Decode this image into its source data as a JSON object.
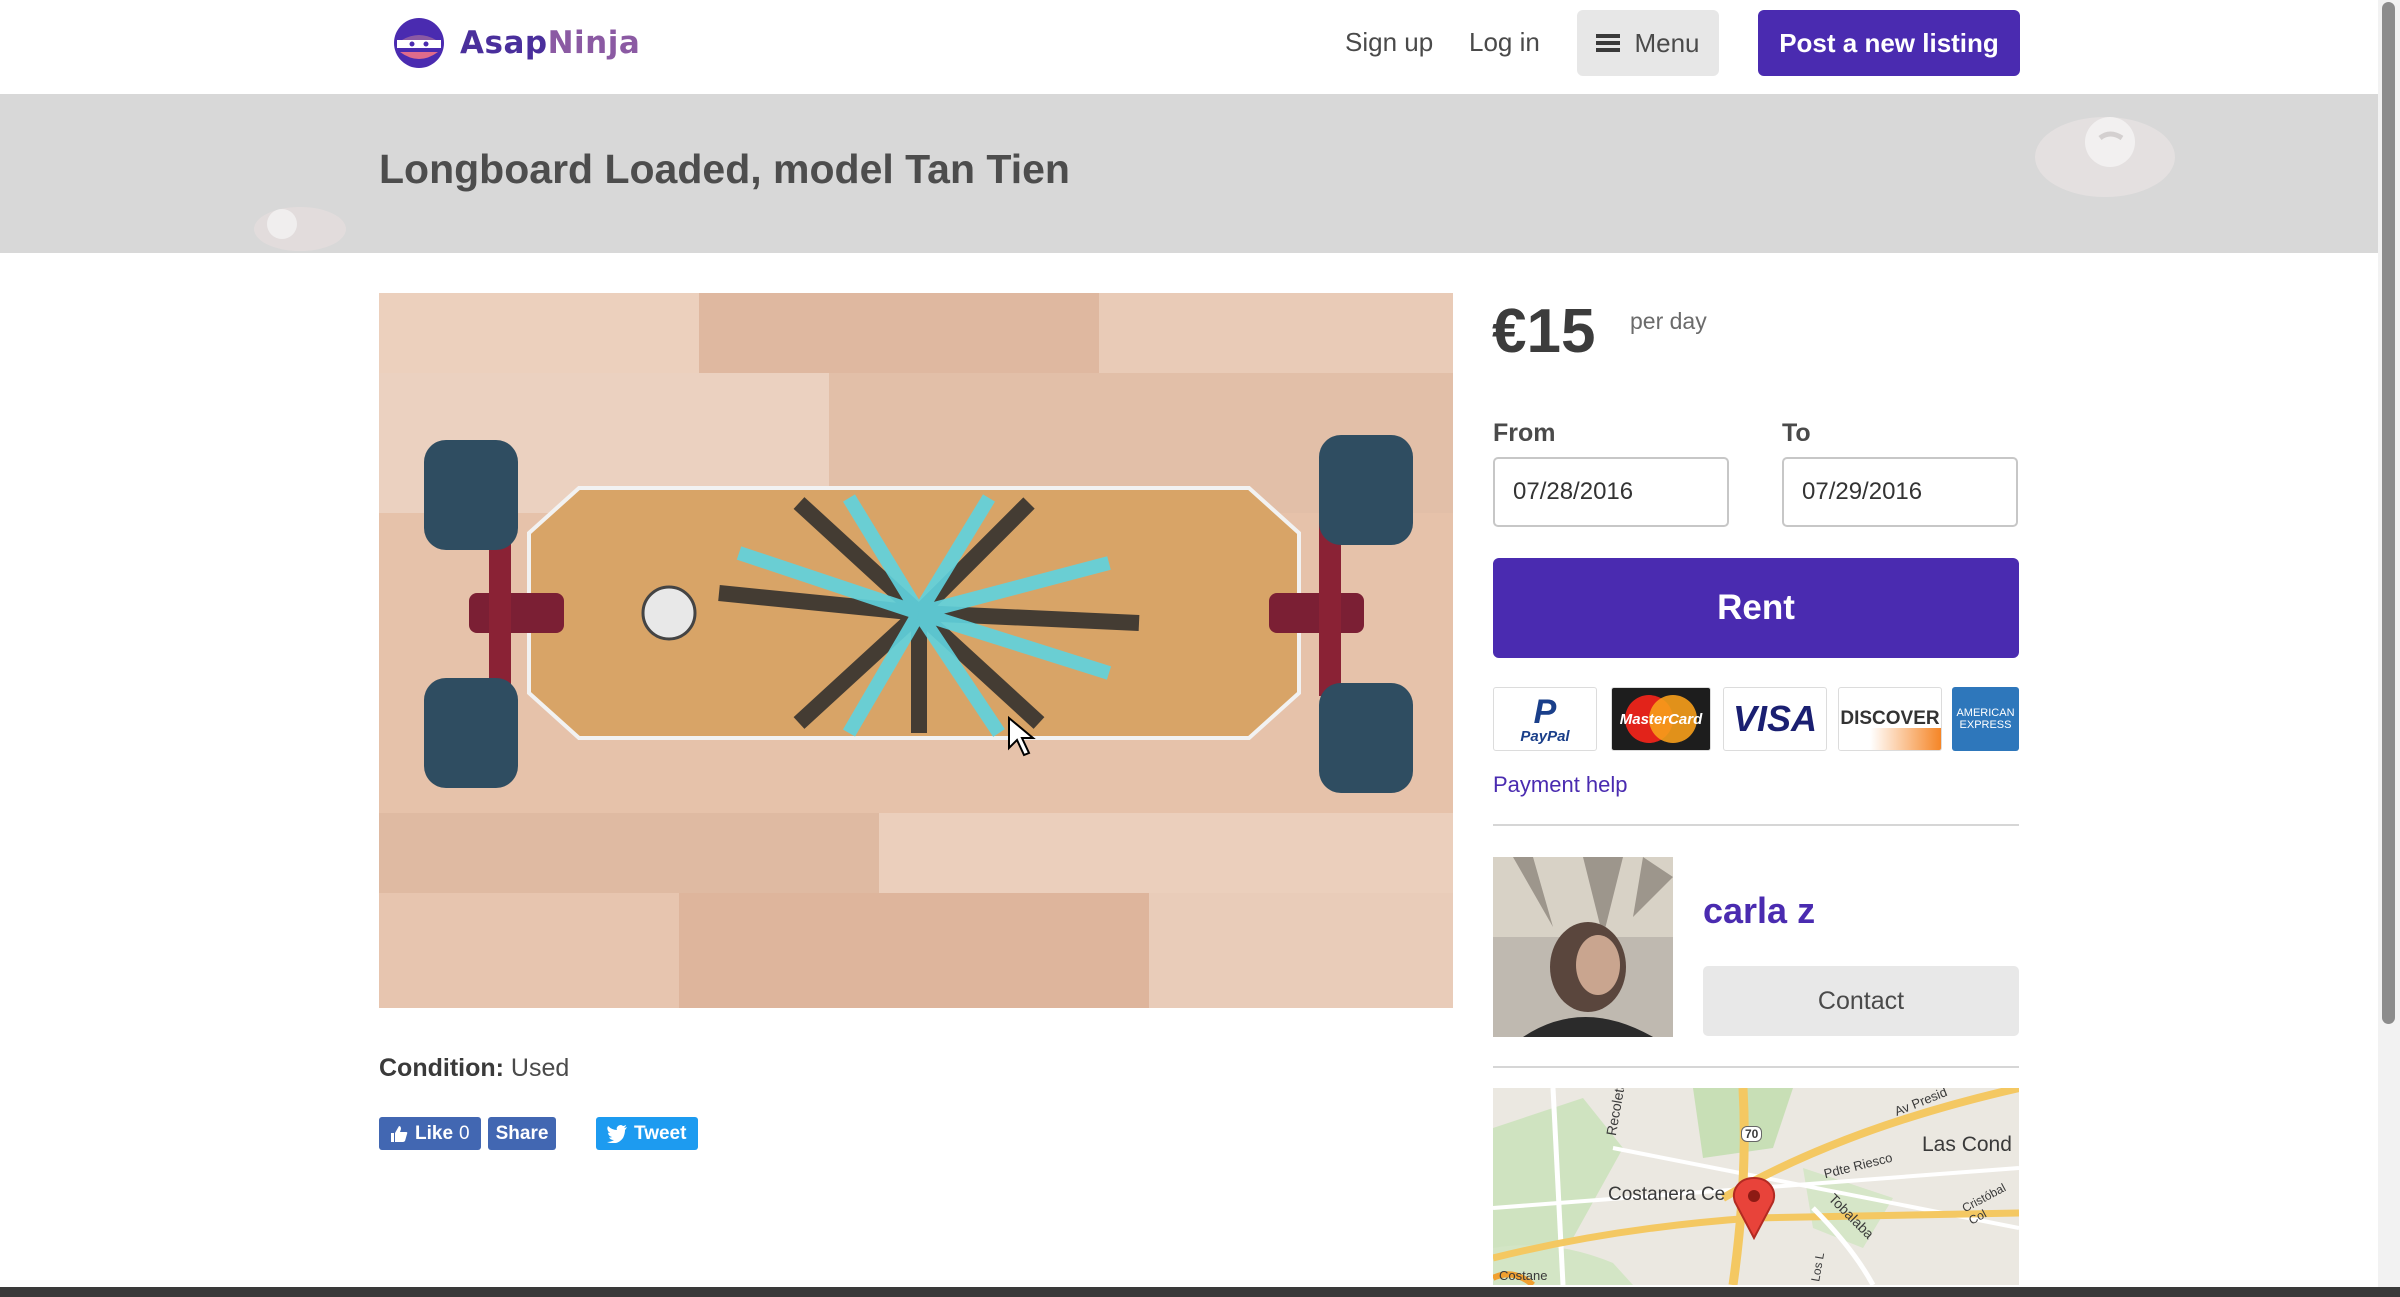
{
  "brand": {
    "name_part1": "Asap",
    "name_part2": "Ninja",
    "logo_icon": "ninja-logo-icon"
  },
  "header": {
    "signup_label": "Sign up",
    "login_label": "Log in",
    "menu_label": "Menu",
    "menu_icon": "hamburger-icon",
    "post_listing_label": "Post a new listing"
  },
  "listing": {
    "title": "Longboard Loaded, model Tan Tien",
    "condition_label": "Condition:",
    "condition_value": "Used"
  },
  "social": {
    "like_label": "Like",
    "like_count": "0",
    "share_label": "Share",
    "tweet_label": "Tweet"
  },
  "booking": {
    "price": "€15",
    "price_unit": "per day",
    "from_label": "From",
    "from_value": "07/28/2016",
    "to_label": "To",
    "to_value": "07/29/2016",
    "rent_label": "Rent",
    "payment_help_label": "Payment help",
    "payment_methods": [
      "PayPal",
      "MasterCard",
      "VISA",
      "DISCOVER",
      "AMERICAN EXPRESS"
    ]
  },
  "author": {
    "name": "carla z",
    "contact_label": "Contact"
  },
  "map": {
    "labels": [
      "Costanera Ce",
      "Las Cond",
      "Recoleta",
      "Av Presid",
      "Pdte Riesco",
      "Tobalaba",
      "Cristóbal Col",
      "Costane",
      "70",
      "Los L"
    ]
  },
  "colors": {
    "brand_purple": "#4a2bb0",
    "hero_gray": "#d8d8d8",
    "menu_gray": "#e7e7e7"
  }
}
